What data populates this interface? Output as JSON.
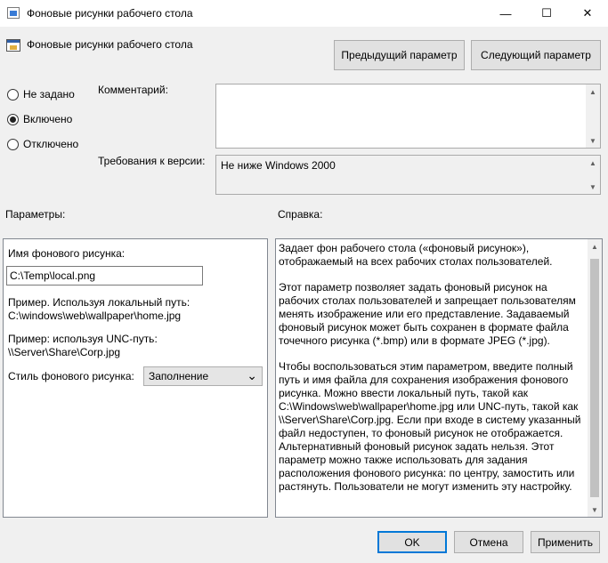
{
  "window": {
    "title": "Фоновые рисунки рабочего стола",
    "minimize": "—",
    "maximize": "☐",
    "close": "✕"
  },
  "header": {
    "title": "Фоновые рисунки рабочего стола",
    "prev_button": "Предыдущий параметр",
    "next_button": "Следующий параметр"
  },
  "state": {
    "options": [
      {
        "label": "Не задано",
        "selected": false
      },
      {
        "label": "Включено",
        "selected": true
      },
      {
        "label": "Отключено",
        "selected": false
      }
    ]
  },
  "comment": {
    "label": "Комментарий:",
    "value": ""
  },
  "supported": {
    "label": "Требования к версии:",
    "value": "Не ниже Windows 2000"
  },
  "options_section": {
    "label": "Параметры:",
    "wallpaper_name_label": "Имя фонового рисунка:",
    "wallpaper_name_value": "C:\\Temp\\local.png",
    "example_local_line1": "Пример. Используя локальный путь:",
    "example_local_line2": "C:\\windows\\web\\wallpaper\\home.jpg",
    "example_unc_line1": "Пример: используя UNC-путь:",
    "example_unc_line2": "\\\\Server\\Share\\Corp.jpg",
    "style_label": "Стиль фонового рисунка:",
    "style_value": "Заполнение"
  },
  "help_section": {
    "label": "Справка:",
    "paragraphs": [
      "Задает фон рабочего стола («фоновый рисунок»), отображаемый на всех рабочих столах пользователей.",
      "Этот параметр позволяет задать фоновый рисунок на рабочих столах пользователей и запрещает пользователям менять изображение или его представление. Задаваемый фоновый рисунок может быть сохранен в формате файла точечного рисунка (*.bmp) или в формате JPEG (*.jpg).",
      "Чтобы воспользоваться этим параметром, введите полный путь и имя файла для сохранения изображения фонового рисунка. Можно ввести локальный путь, такой как C:\\Windows\\web\\wallpaper\\home.jpg или UNC-путь, такой как \\\\Server\\Share\\Corp.jpg. Если при входе в систему указанный файл недоступен, то фоновый рисунок не отображается. Альтернативный фоновый рисунок задать нельзя. Этот параметр можно также использовать для задания расположения фонового рисунка: по центру, замостить или растянуть. Пользователи не могут изменить эту настройку."
    ]
  },
  "footer": {
    "ok": "OK",
    "cancel": "Отмена",
    "apply": "Применить"
  },
  "icons": {
    "window_icon": "policy-window-icon",
    "header_icon": "policy-setting-icon",
    "scroll_up": "▲",
    "scroll_down": "▼",
    "dropdown": "⌄"
  },
  "colors": {
    "accent": "#0078d7",
    "background": "#f0f0f0"
  }
}
